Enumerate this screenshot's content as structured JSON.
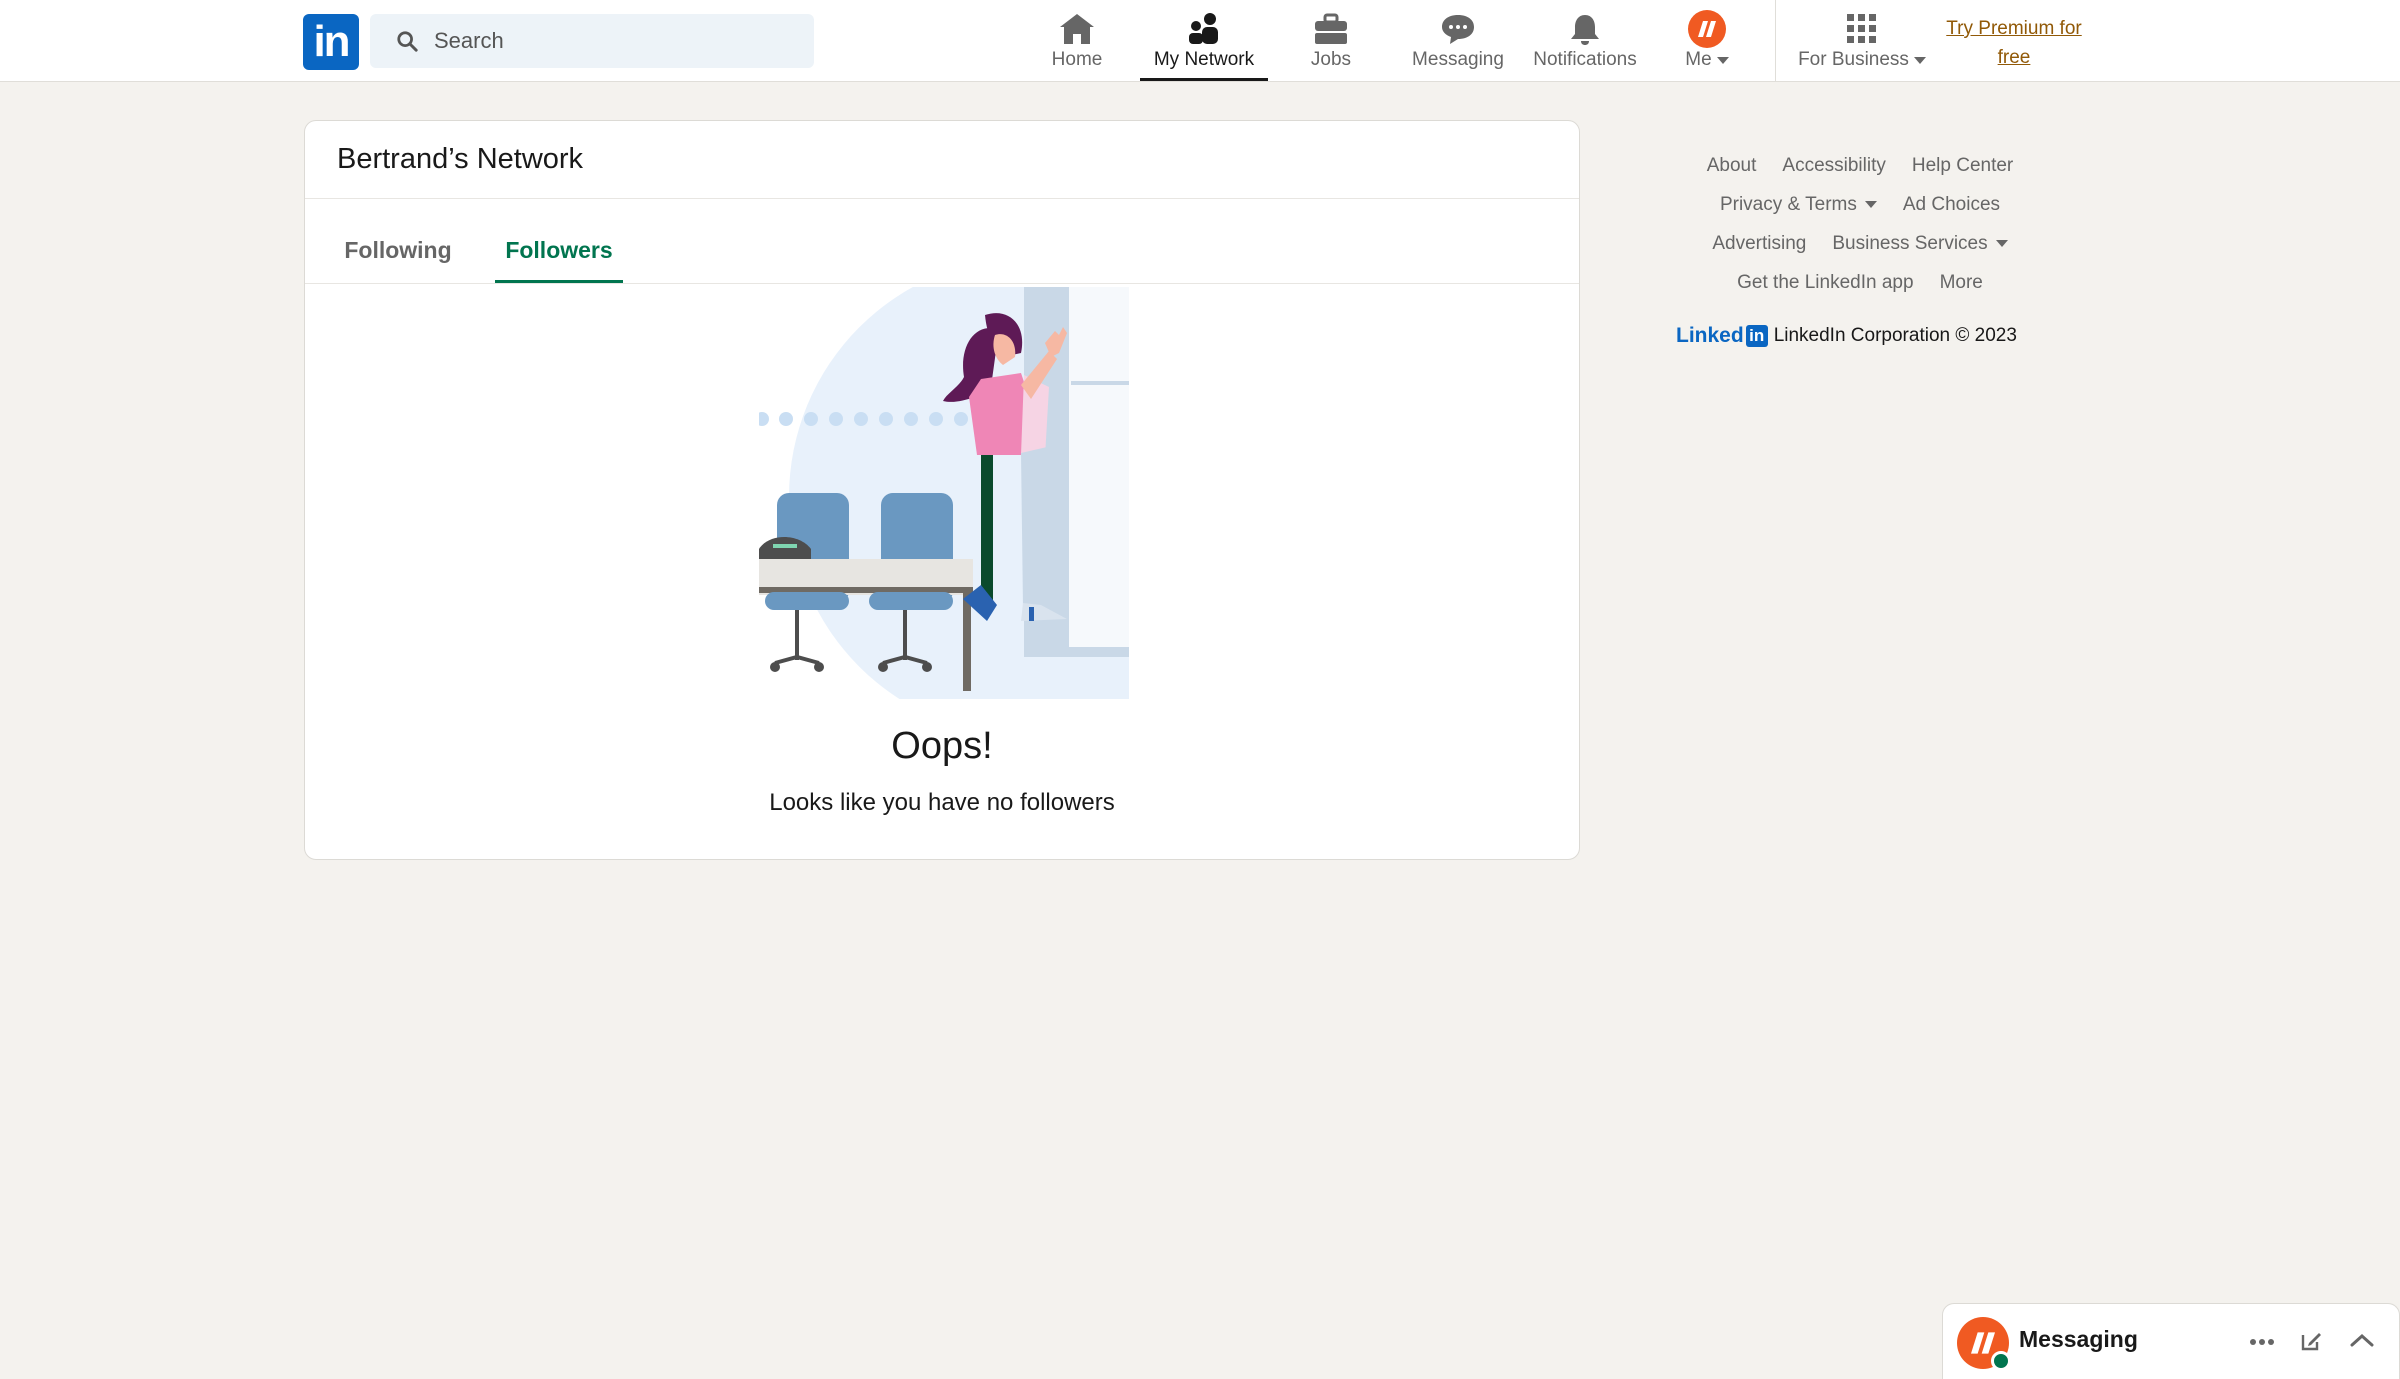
{
  "search": {
    "placeholder": "Search"
  },
  "nav": {
    "home": "Home",
    "network": "My Network",
    "jobs": "Jobs",
    "messaging": "Messaging",
    "notifications": "Notifications",
    "me": "Me",
    "business": "For Business",
    "premium_line1": "Try Premium for",
    "premium_line2": "free"
  },
  "card": {
    "title": "Bertrand’s Network",
    "tabs": [
      "Following",
      "Followers"
    ],
    "active_tab": "Followers",
    "empty_title": "Oops!",
    "empty_subtitle": "Looks like you have no followers"
  },
  "footer": {
    "about": "About",
    "accessibility": "Accessibility",
    "help": "Help Center",
    "privacy": "Privacy & Terms",
    "adchoices": "Ad Choices",
    "advertising": "Advertising",
    "business_services": "Business Services",
    "get_app": "Get the LinkedIn app",
    "more": "More",
    "brand_word": "Linked",
    "brand_in": "in",
    "copyright": "LinkedIn Corporation © 2023"
  },
  "messaging_dock": {
    "label": "Messaging"
  },
  "colors": {
    "brand_blue": "#0a66c2",
    "active_green": "#01754f",
    "premium_gold": "#915907",
    "avatar_orange": "#f05a22",
    "page_bg": "#f4f2ee"
  }
}
